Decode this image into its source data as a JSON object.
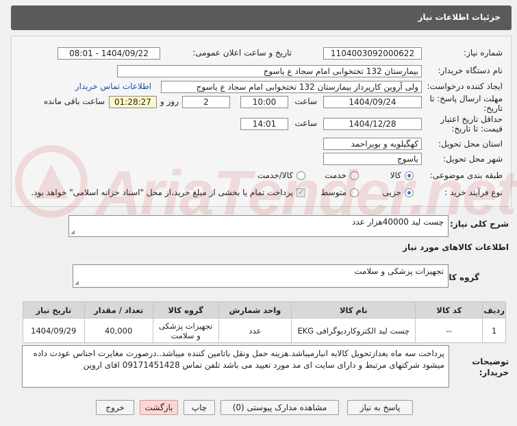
{
  "title": "جزئیات اطلاعات نیاز",
  "form": {
    "need_number_label": "شماره نیاز:",
    "need_number": "1104003092000622",
    "announce_label": "تاریخ و ساعت اعلان عمومی:",
    "announce_value": "1404/09/22 - 08:01",
    "buyer_org_label": "نام دستگاه خریدار:",
    "buyer_org": "بیمارستان 132 تختخوابی امام سجاد  ع  یاسوج",
    "creator_label": "ایجاد کننده درخواست:",
    "creator": "ولی آروین کارپرداز بیمارستان 132 تختخوابی امام سجاد  ع  یاسوج",
    "contact_link": "اطلاعات تماس خریدار",
    "reply_deadline_label": "مهلت ارسال پاسخ: تا تاریخ:",
    "reply_date": "1404/09/24",
    "time_label": "ساعت",
    "reply_time": "10:00",
    "days_value": "2",
    "days_label": "روز و",
    "remaining_time": "01:28:27",
    "remaining_label": "ساعت باقی مانده",
    "validity_label": "حداقل تاریخ اعتبار قیمت: تا تاریخ:",
    "validity_date": "1404/12/28",
    "validity_time": "14:01",
    "province_label": "استان محل تحویل:",
    "province": "کهگیلویه و بویراحمد",
    "city_label": "شهر محل تحویل:",
    "city": "یاسوج",
    "category_label": "طبقه بندی موضوعی:",
    "category_options": [
      "کالا",
      "خدمت",
      "کالا/خدمت"
    ],
    "category_selected": "کالا",
    "process_label": "نوع فرآیند خرید :",
    "process_options": [
      "جزیی",
      "متوسط"
    ],
    "process_selected": "جزیی",
    "payment_note": "پرداخت تمام یا بخشی از مبلغ خرید،از محل \"اسناد خزانه اسلامی\" خواهد بود."
  },
  "summary": {
    "label": "شرح کلی نیاز:",
    "value": "چست لید  40000هزار عدد"
  },
  "goods_info_label": "اطلاعات کالاهای مورد نیاز",
  "goods_group": {
    "label": "گروه کالا:",
    "value": "تجهیزات پزشکی و سلامت"
  },
  "table": {
    "headers": [
      "ردیف",
      "کد کالا",
      "نام کالا",
      "واحد شمارش",
      "گروه کالا",
      "تعداد / مقدار",
      "تاریخ نیاز"
    ],
    "rows": [
      [
        "1",
        "--",
        "چست لید الکتروکاردیوگرافی EKG",
        "عدد",
        "تجهیزات پزشکی و سلامت",
        "40,000",
        "1404/09/29"
      ]
    ]
  },
  "notes": {
    "label": "توضیحات خریدار:",
    "value": "پرداخت سه ماه بعدازتحویل کالابه انبارمیباشد.هزینه حمل ونقل باتامین کننده میباشد..درصورت مغایرت اجناس عودت داده میشود شرکتهای مرتبط  و دارای سایت ای مد مورد تعیید می باشد  تلفن تماس 09171451428 اقای اروین"
  },
  "buttons": {
    "reply": "پاسخ به نیاز",
    "attachments": "مشاهده مدارک پیوستی (0)",
    "print": "چاپ",
    "back": "بازگشت",
    "exit": "خروج"
  },
  "watermark": {
    "text": "AriaTender.net"
  },
  "colors": {
    "titlebar": "#5a5a5a",
    "link": "#1a4fb5",
    "timer_bg": "#fff7c8",
    "back_button": "#ffd5d5"
  }
}
